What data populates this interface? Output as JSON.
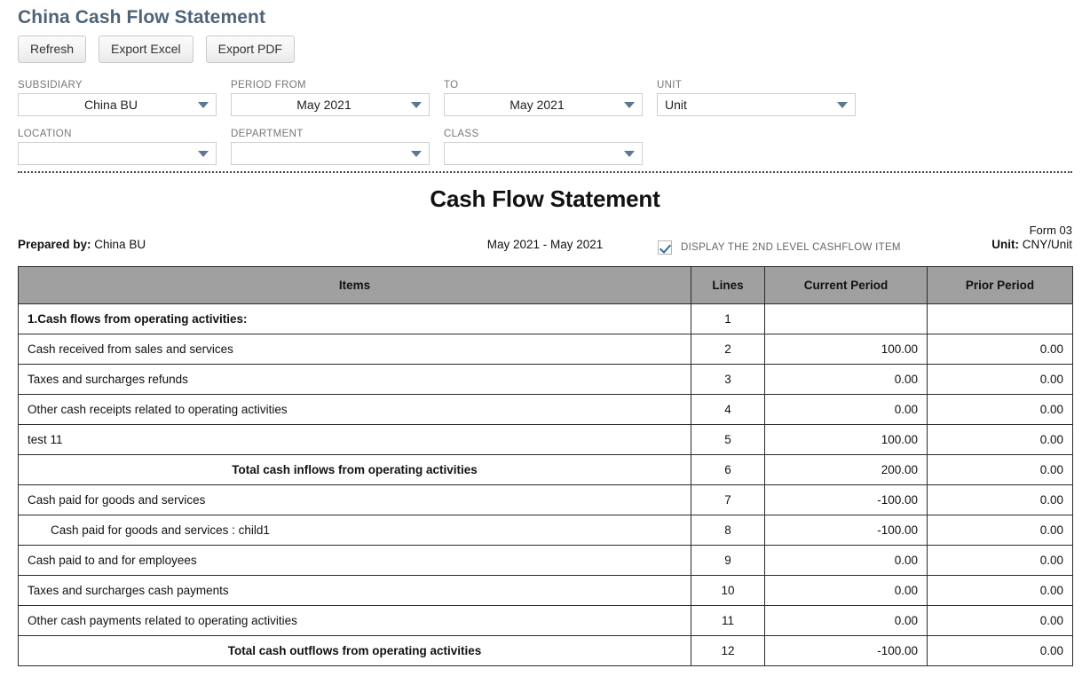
{
  "page": {
    "title": "China Cash Flow Statement"
  },
  "toolbar": {
    "refresh_label": "Refresh",
    "export_excel_label": "Export Excel",
    "export_pdf_label": "Export PDF"
  },
  "filters": {
    "subsidiary": {
      "label": "SUBSIDIARY",
      "value": "China BU"
    },
    "period_from": {
      "label": "PERIOD FROM",
      "value": "May 2021"
    },
    "period_to": {
      "label": "TO",
      "value": "May 2021"
    },
    "unit": {
      "label": "UNIT",
      "value": "Unit"
    },
    "location": {
      "label": "LOCATION",
      "value": ""
    },
    "department": {
      "label": "DEPARTMENT",
      "value": ""
    },
    "class": {
      "label": "CLASS",
      "value": ""
    },
    "display_second_level": {
      "label": "DISPLAY THE 2ND LEVEL CASHFLOW ITEM",
      "checked": true
    }
  },
  "report": {
    "title": "Cash Flow Statement",
    "form_no": "Form 03",
    "prepared_by_label": "Prepared by:",
    "prepared_by_value": "China BU",
    "period_range": "May 2021 - May 2021",
    "unit_label": "Unit:",
    "unit_value": "CNY/Unit",
    "columns": {
      "items": "Items",
      "lines": "Lines",
      "current_period": "Current Period",
      "prior_period": "Prior Period"
    },
    "rows": [
      {
        "item": "1.Cash flows from operating activities:",
        "line": "1",
        "current": "",
        "prior": "",
        "style": "head"
      },
      {
        "item": "Cash received from sales and services",
        "line": "2",
        "current": "100.00",
        "prior": "0.00",
        "style": "normal"
      },
      {
        "item": "Taxes and surcharges refunds",
        "line": "3",
        "current": "0.00",
        "prior": "0.00",
        "style": "normal"
      },
      {
        "item": "Other cash receipts related to operating activities",
        "line": "4",
        "current": "0.00",
        "prior": "0.00",
        "style": "normal"
      },
      {
        "item": "test 11",
        "line": "5",
        "current": "100.00",
        "prior": "0.00",
        "style": "normal"
      },
      {
        "item": "Total cash inflows from operating activities",
        "line": "6",
        "current": "200.00",
        "prior": "0.00",
        "style": "total"
      },
      {
        "item": "Cash paid for goods and services",
        "line": "7",
        "current": "-100.00",
        "prior": "0.00",
        "style": "normal"
      },
      {
        "item": "Cash paid for goods and services : child1",
        "line": "8",
        "current": "-100.00",
        "prior": "0.00",
        "style": "lvl2"
      },
      {
        "item": "Cash paid to and for employees",
        "line": "9",
        "current": "0.00",
        "prior": "0.00",
        "style": "normal"
      },
      {
        "item": "Taxes and surcharges cash payments",
        "line": "10",
        "current": "0.00",
        "prior": "0.00",
        "style": "normal"
      },
      {
        "item": "Other cash payments related to operating activities",
        "line": "11",
        "current": "0.00",
        "prior": "0.00",
        "style": "normal"
      },
      {
        "item": "Total cash outflows from operating activities",
        "line": "12",
        "current": "-100.00",
        "prior": "0.00",
        "style": "total"
      }
    ]
  },
  "colors": {
    "title": "#4f6478",
    "table_header_bg": "#a0a0a0",
    "caret": "#5a7795",
    "checkmark": "#2d6ca8"
  }
}
